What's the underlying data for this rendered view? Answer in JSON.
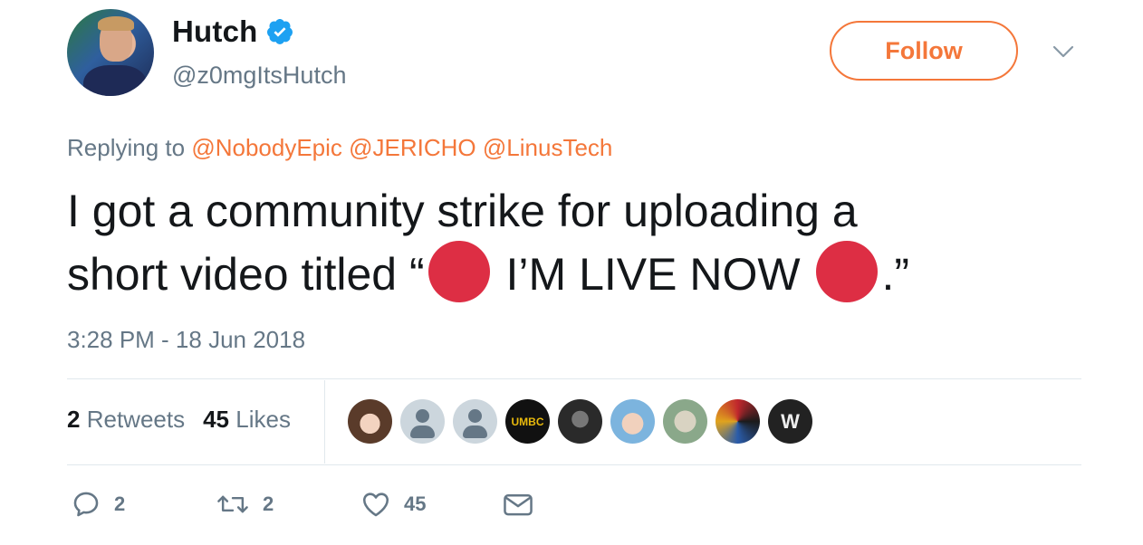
{
  "author": {
    "name": "Hutch",
    "handle": "@z0mgItsHutch",
    "verified": true
  },
  "follow_button": {
    "label": "Follow"
  },
  "reply_context": {
    "prefix": "Replying to",
    "mentions": [
      "@NobodyEpic",
      "@JERICHO",
      "@LinusTech"
    ]
  },
  "tweet": {
    "line1": "I got a community strike for uploading a",
    "part_a": "short video titled “",
    "part_b": " I’M LIVE NOW ",
    "part_c": ".”",
    "timestamp": "3:28 PM - 18 Jun 2018"
  },
  "stats": {
    "retweets_count": "2",
    "retweets_label": "Retweets",
    "likes_count": "45",
    "likes_label": "Likes"
  },
  "likers": {
    "umbc_text": "UMBC",
    "wwe_text": "W"
  },
  "actions": {
    "reply_count": "2",
    "retweet_count": "2",
    "like_count": "45"
  },
  "colors": {
    "accent": "#f4773a",
    "verified": "#1da1f2",
    "red_circle": "#dd2e44",
    "secondary_text": "#657786"
  },
  "icons": [
    "verified-badge-icon",
    "chevron-down-icon",
    "reply-icon",
    "retweet-icon",
    "heart-icon",
    "mail-icon",
    "red-circle-emoji-icon"
  ]
}
